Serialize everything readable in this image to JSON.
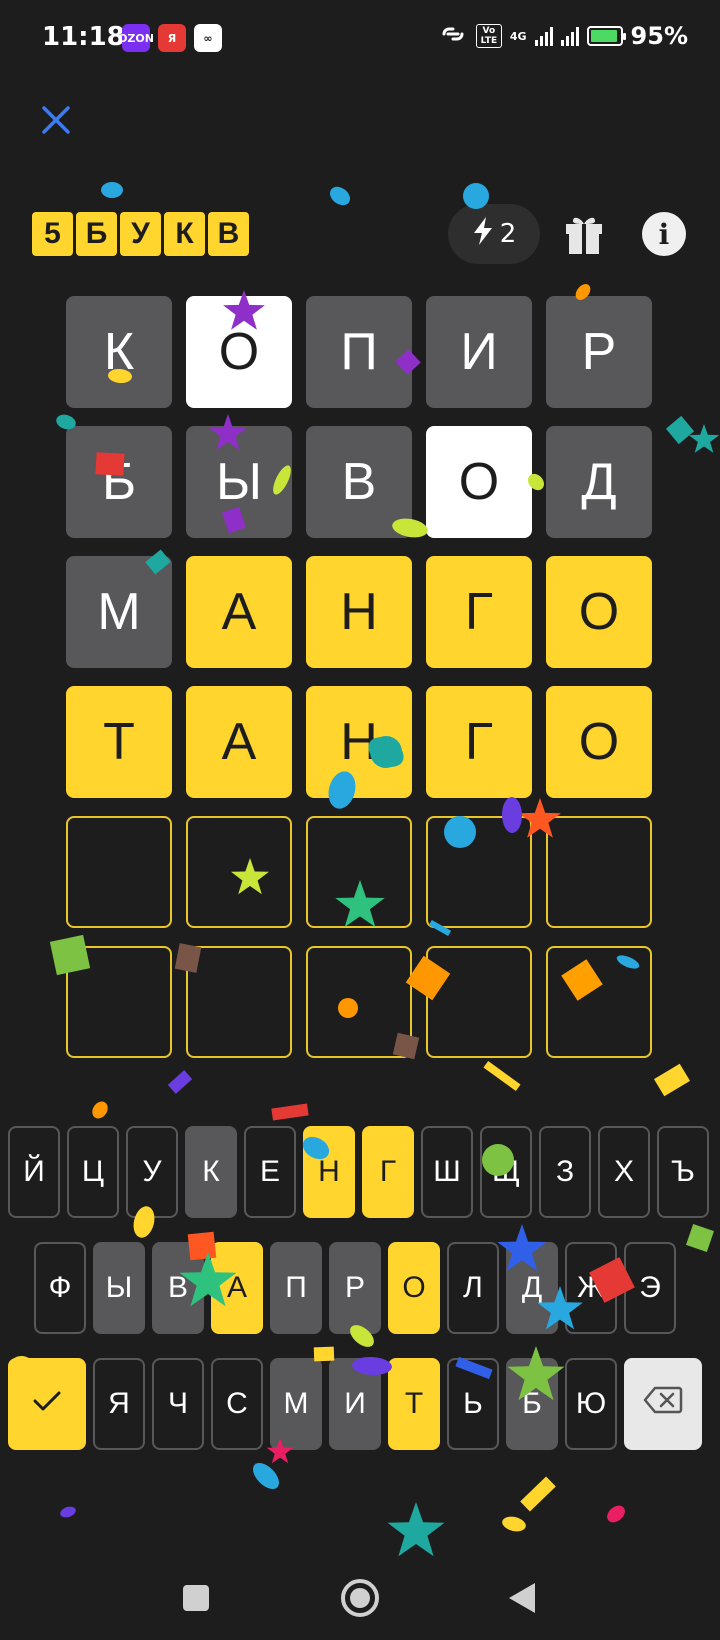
{
  "status_bar": {
    "time": "11:18",
    "apps": [
      {
        "name": "ozon",
        "label": "OZON",
        "bg": "#7b2ff2",
        "fg": "#ffffff"
      },
      {
        "name": "yandex",
        "label": "Я",
        "bg": "#e53935",
        "fg": "#ffffff"
      },
      {
        "name": "link",
        "label": "∞",
        "bg": "#ffffff",
        "fg": "#1e1d1e"
      }
    ],
    "volte": "Vo LTE",
    "network": "4G",
    "battery_percent": "95%",
    "battery_level": 0.95
  },
  "header": {
    "logo_letters": [
      "5",
      "Б",
      "У",
      "К",
      "В"
    ],
    "hints_count": "2"
  },
  "board": {
    "rows": [
      [
        {
          "l": "К",
          "s": "absent"
        },
        {
          "l": "О",
          "s": "present"
        },
        {
          "l": "П",
          "s": "absent"
        },
        {
          "l": "И",
          "s": "absent"
        },
        {
          "l": "Р",
          "s": "absent"
        }
      ],
      [
        {
          "l": "Б",
          "s": "absent"
        },
        {
          "l": "Ы",
          "s": "absent"
        },
        {
          "l": "В",
          "s": "absent"
        },
        {
          "l": "О",
          "s": "present"
        },
        {
          "l": "Д",
          "s": "absent"
        }
      ],
      [
        {
          "l": "М",
          "s": "absent"
        },
        {
          "l": "А",
          "s": "correct"
        },
        {
          "l": "Н",
          "s": "correct"
        },
        {
          "l": "Г",
          "s": "correct"
        },
        {
          "l": "О",
          "s": "correct"
        }
      ],
      [
        {
          "l": "Т",
          "s": "correct"
        },
        {
          "l": "А",
          "s": "correct"
        },
        {
          "l": "Н",
          "s": "correct"
        },
        {
          "l": "Г",
          "s": "correct"
        },
        {
          "l": "О",
          "s": "correct"
        }
      ],
      [
        {
          "l": "",
          "s": "empty"
        },
        {
          "l": "",
          "s": "empty"
        },
        {
          "l": "",
          "s": "empty"
        },
        {
          "l": "",
          "s": "empty"
        },
        {
          "l": "",
          "s": "empty"
        }
      ],
      [
        {
          "l": "",
          "s": "empty"
        },
        {
          "l": "",
          "s": "empty"
        },
        {
          "l": "",
          "s": "empty"
        },
        {
          "l": "",
          "s": "empty"
        },
        {
          "l": "",
          "s": "empty"
        }
      ]
    ]
  },
  "keyboard": {
    "row1": [
      {
        "k": "Й",
        "s": ""
      },
      {
        "k": "Ц",
        "s": ""
      },
      {
        "k": "У",
        "s": ""
      },
      {
        "k": "К",
        "s": "absent"
      },
      {
        "k": "Е",
        "s": ""
      },
      {
        "k": "Н",
        "s": "correct"
      },
      {
        "k": "Г",
        "s": "correct"
      },
      {
        "k": "Ш",
        "s": ""
      },
      {
        "k": "Щ",
        "s": ""
      },
      {
        "k": "З",
        "s": ""
      },
      {
        "k": "Х",
        "s": ""
      },
      {
        "k": "Ъ",
        "s": ""
      }
    ],
    "row2": [
      {
        "k": "Ф",
        "s": ""
      },
      {
        "k": "Ы",
        "s": "absent"
      },
      {
        "k": "В",
        "s": "absent"
      },
      {
        "k": "А",
        "s": "correct"
      },
      {
        "k": "П",
        "s": "absent"
      },
      {
        "k": "Р",
        "s": "absent"
      },
      {
        "k": "О",
        "s": "correct"
      },
      {
        "k": "Л",
        "s": ""
      },
      {
        "k": "Д",
        "s": "absent"
      },
      {
        "k": "Ж",
        "s": ""
      },
      {
        "k": "Э",
        "s": ""
      }
    ],
    "row3": [
      {
        "k": "Я",
        "s": ""
      },
      {
        "k": "Ч",
        "s": ""
      },
      {
        "k": "С",
        "s": ""
      },
      {
        "k": "М",
        "s": "absent"
      },
      {
        "k": "И",
        "s": "absent"
      },
      {
        "k": "Т",
        "s": "correct"
      },
      {
        "k": "Ь",
        "s": ""
      },
      {
        "k": "Б",
        "s": "absent"
      },
      {
        "k": "Ю",
        "s": ""
      }
    ]
  },
  "colors": {
    "background": "#1e1d1e",
    "correct": "#ffd52e",
    "absent": "#58575a",
    "present": "#ffffff",
    "close_icon": "#3d7bf0"
  },
  "icons": {
    "close": "close-icon",
    "hint": "lightning-icon",
    "gift": "gift-icon",
    "info": "info-icon",
    "enter": "checkmark-icon",
    "backspace": "backspace-icon"
  }
}
